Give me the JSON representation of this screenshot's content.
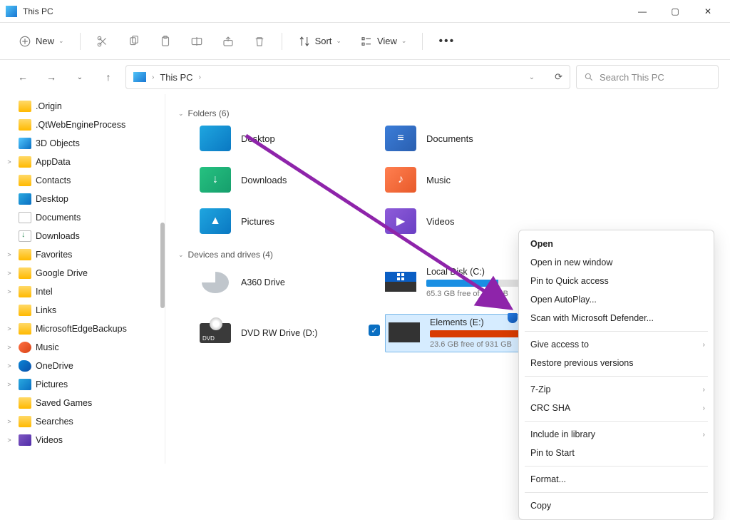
{
  "window": {
    "title": "This PC",
    "min": "—",
    "max": "▢",
    "close": "✕"
  },
  "toolbar": {
    "new": "New",
    "sort": "Sort",
    "view": "View"
  },
  "nav": {
    "back": "←",
    "forward": "→",
    "up": "↑",
    "dropdown": "⌄",
    "refresh": "⟳"
  },
  "address": {
    "root": "This PC",
    "sep": "›"
  },
  "search": {
    "placeholder": "Search This PC"
  },
  "sidebar": [
    {
      "label": ".Origin",
      "icon": "folder",
      "expand": ""
    },
    {
      "label": ".QtWebEngineProcess",
      "icon": "folder",
      "expand": ""
    },
    {
      "label": "3D Objects",
      "icon": "bluecube",
      "expand": ""
    },
    {
      "label": "AppData",
      "icon": "folder",
      "expand": ">"
    },
    {
      "label": "Contacts",
      "icon": "folder",
      "expand": ""
    },
    {
      "label": "Desktop",
      "icon": "desktopic",
      "expand": ""
    },
    {
      "label": "Documents",
      "icon": "docic",
      "expand": ""
    },
    {
      "label": "Downloads",
      "icon": "dlic",
      "expand": ""
    },
    {
      "label": "Favorites",
      "icon": "folder",
      "expand": ">"
    },
    {
      "label": "Google Drive",
      "icon": "folder",
      "expand": ">"
    },
    {
      "label": "Intel",
      "icon": "folder",
      "expand": ">"
    },
    {
      "label": "Links",
      "icon": "folder",
      "expand": ""
    },
    {
      "label": "MicrosoftEdgeBackups",
      "icon": "folder",
      "expand": ">"
    },
    {
      "label": "Music",
      "icon": "musicic",
      "expand": ">"
    },
    {
      "label": "OneDrive",
      "icon": "onedriveic",
      "expand": ">"
    },
    {
      "label": "Pictures",
      "icon": "picic",
      "expand": ">"
    },
    {
      "label": "Saved Games",
      "icon": "folder",
      "expand": ""
    },
    {
      "label": "Searches",
      "icon": "folder",
      "expand": ">"
    },
    {
      "label": "Videos",
      "icon": "videoic",
      "expand": ">"
    }
  ],
  "sections": {
    "folders_title": "Folders (6)",
    "drives_title": "Devices and drives (4)"
  },
  "folders": [
    {
      "name": "Desktop",
      "cls": "blue",
      "glyph": ""
    },
    {
      "name": "Documents",
      "cls": "bluemed",
      "glyph": "≡"
    },
    {
      "name": "Downloads",
      "cls": "green",
      "glyph": "↓"
    },
    {
      "name": "Music",
      "cls": "orange",
      "glyph": "♪"
    },
    {
      "name": "Pictures",
      "cls": "teal",
      "glyph": "▲"
    },
    {
      "name": "Videos",
      "cls": "purple",
      "glyph": "▶"
    }
  ],
  "drives": {
    "a360": "A360 Drive",
    "dvd": "DVD RW Drive (D:)",
    "local": {
      "name": "Local Disk (C:)",
      "free": "65.3 GB free of 237 GB",
      "fill_color": "#1a8fe3",
      "fill_pct": 72
    },
    "elements": {
      "name": "Elements (E:)",
      "free": "23.6 GB free of 931 GB",
      "fill_color": "#d83b01",
      "fill_pct": 97
    }
  },
  "context": {
    "open": "Open",
    "open_new": "Open in new window",
    "pin_qa": "Pin to Quick access",
    "autoplay": "Open AutoPlay...",
    "scan": "Scan with Microsoft Defender...",
    "give": "Give access to",
    "restore": "Restore previous versions",
    "sevenzip": "7-Zip",
    "crc": "CRC SHA",
    "include": "Include in library",
    "pin_start": "Pin to Start",
    "format": "Format...",
    "copy": "Copy"
  }
}
